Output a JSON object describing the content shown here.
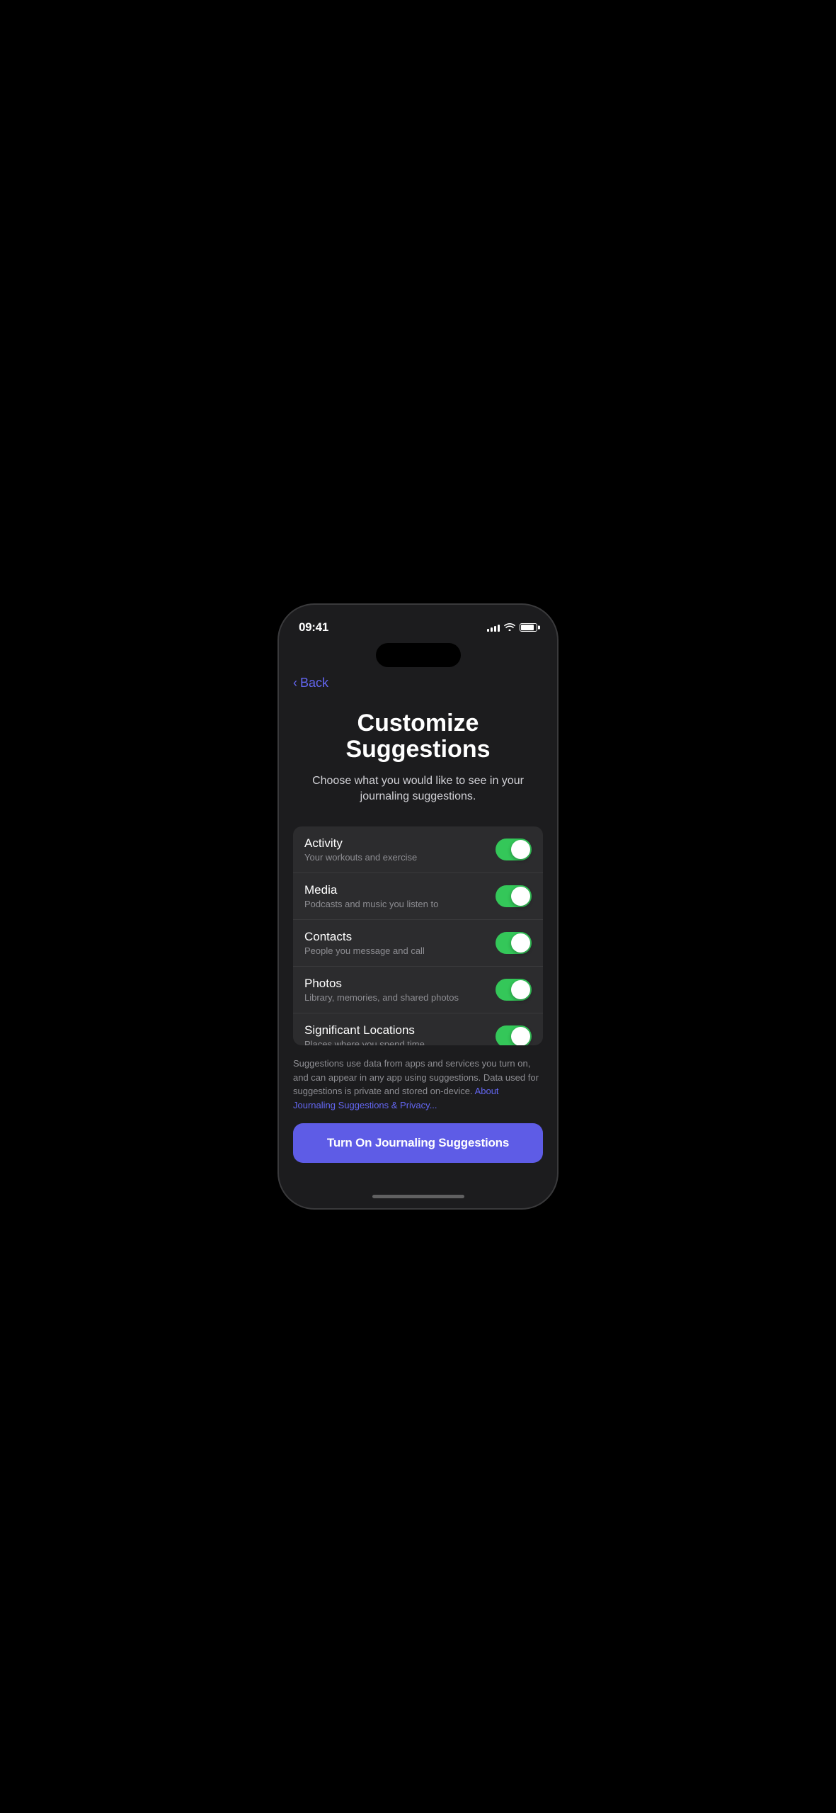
{
  "statusBar": {
    "time": "09:41",
    "signalBars": [
      4,
      6,
      8,
      10,
      12
    ],
    "batteryLevel": 85
  },
  "navigation": {
    "backLabel": "Back"
  },
  "header": {
    "title": "Customize Suggestions",
    "subtitle": "Choose what you would like to see in your journaling suggestions."
  },
  "settingsRows": [
    {
      "id": "activity",
      "title": "Activity",
      "subtitle": "Your workouts and exercise",
      "enabled": true
    },
    {
      "id": "media",
      "title": "Media",
      "subtitle": "Podcasts and music you listen to",
      "enabled": true
    },
    {
      "id": "contacts",
      "title": "Contacts",
      "subtitle": "People you message and call",
      "enabled": true
    },
    {
      "id": "photos",
      "title": "Photos",
      "subtitle": "Library, memories, and shared photos",
      "enabled": true
    },
    {
      "id": "significant-locations",
      "title": "Significant Locations",
      "subtitle": "Places where you spend time",
      "enabled": true
    }
  ],
  "privacyNote": {
    "text": "Suggestions use data from apps and services you turn on, and can appear in any app using suggestions. Data used for suggestions is private and stored on-device.",
    "linkText": "About Journaling Suggestions & Privacy..."
  },
  "cta": {
    "label": "Turn On Journaling Suggestions"
  }
}
